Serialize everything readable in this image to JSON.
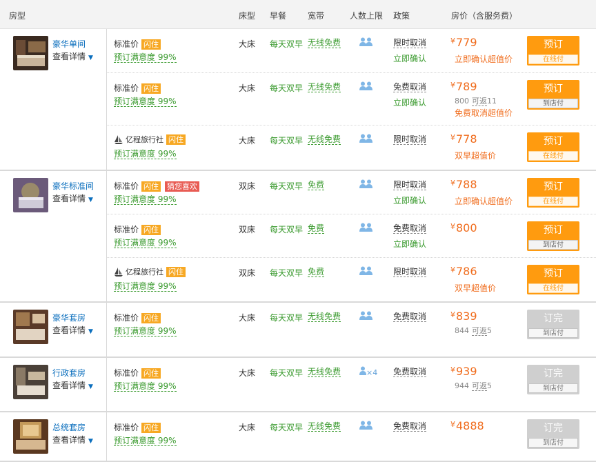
{
  "header": {
    "room_type": "房型",
    "bed": "床型",
    "breakfast": "早餐",
    "broadband": "宽带",
    "occupancy": "人数上限",
    "policy": "政策",
    "price": "房价（含服务费）"
  },
  "common": {
    "standard_price": "标准价",
    "flash": "闪住",
    "guess_like": "猜您喜欢",
    "satisfaction": "预订满意度 99%",
    "view_details": "查看详情",
    "ctrip_name": "亿程旅行社",
    "currency": "¥",
    "cashback_label": "可返"
  },
  "rooms": [
    {
      "name": "豪华单间",
      "offers": [
        {
          "bed": "大床",
          "breakfast": "每天双早",
          "net": "无线免费",
          "policy": "限时取消",
          "confirm": "立即确认",
          "price": "779",
          "note": "立即确认超值价",
          "btn": "预订",
          "pay": "在线付"
        },
        {
          "bed": "大床",
          "breakfast": "每天双早",
          "net": "无线免费",
          "policy": "免费取消",
          "confirm": "立即确认",
          "price": "789",
          "orig": "800",
          "cashback": "11",
          "note": "免费取消超值价",
          "btn": "预订",
          "pay": "到店付"
        },
        {
          "bed": "大床",
          "breakfast": "每天双早",
          "net": "无线免费",
          "policy": "限时取消",
          "price": "778",
          "note": "双早超值价",
          "btn": "预订",
          "pay": "在线付"
        }
      ]
    },
    {
      "name": "豪华标准间",
      "offers": [
        {
          "bed": "双床",
          "breakfast": "每天双早",
          "net": "免费",
          "policy": "限时取消",
          "confirm": "立即确认",
          "price": "788",
          "note": "立即确认超值价",
          "btn": "预订",
          "pay": "在线付"
        },
        {
          "bed": "双床",
          "breakfast": "每天双早",
          "net": "免费",
          "policy": "免费取消",
          "confirm": "立即确认",
          "price": "800",
          "btn": "预订",
          "pay": "到店付"
        },
        {
          "bed": "双床",
          "breakfast": "每天双早",
          "net": "免费",
          "policy": "限时取消",
          "price": "786",
          "note": "双早超值价",
          "btn": "预订",
          "pay": "在线付"
        }
      ]
    },
    {
      "name": "豪华套房",
      "offers": [
        {
          "bed": "大床",
          "breakfast": "每天双早",
          "net": "无线免费",
          "policy": "免费取消",
          "price": "839",
          "orig": "844",
          "cashback": "5",
          "btn": "订完",
          "pay": "到店付"
        }
      ]
    },
    {
      "name": "行政套房",
      "offers": [
        {
          "bed": "大床",
          "breakfast": "每天双早",
          "net": "无线免费",
          "policy": "免费取消",
          "price": "939",
          "orig": "944",
          "cashback": "5",
          "occupancy_text": "×4",
          "btn": "订完",
          "pay": "到店付"
        }
      ]
    },
    {
      "name": "总统套房",
      "offers": [
        {
          "bed": "大床",
          "breakfast": "每天双早",
          "net": "无线免费",
          "policy": "免费取消",
          "price": "4888",
          "btn": "订完",
          "pay": "到店付"
        }
      ]
    }
  ]
}
